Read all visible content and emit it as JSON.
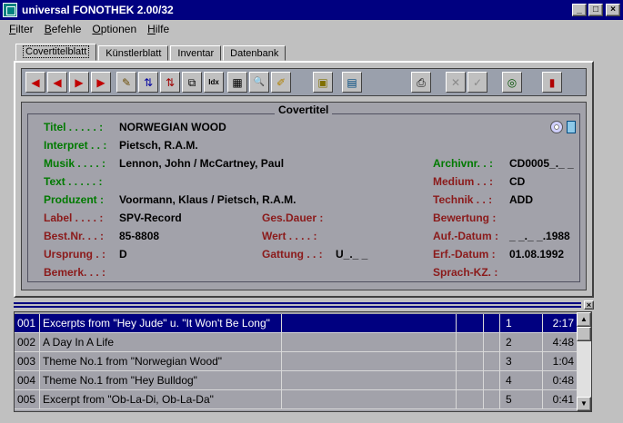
{
  "window": {
    "title": "universal FONOTHEK   2.00/32",
    "minimize": "_",
    "maximize": "□",
    "close": "×"
  },
  "menu": [
    "Filter",
    "Befehle",
    "Optionen",
    "Hilfe"
  ],
  "tabs": [
    "Covertitelblatt",
    "Künstlerblatt",
    "Inventar",
    "Datenbank"
  ],
  "toolbar": {
    "first": "◀",
    "prev": "◀",
    "next": "▶",
    "last": "▶",
    "edit": "✎",
    "sort_asc": "⇅",
    "sort_desc": "⇅",
    "copy": "⧉",
    "index": "Idx",
    "table": "▦",
    "search": "🔍",
    "clean": "✐",
    "archive": "▣",
    "cover": "▤",
    "print": "⎙",
    "cancel": "✕",
    "ok": "✓",
    "cd": "◎",
    "exit": "▮"
  },
  "cover": {
    "heading": "Covertitel",
    "titel_label": "Titel . . . . . :",
    "titel": "NORWEGIAN WOOD",
    "interpret_label": "Interpret . . :",
    "interpret": "Pietsch, R.A.M.",
    "musik_label": "Musik . . . . :",
    "musik": "Lennon, John / McCartney, Paul",
    "text_label": "Text . . . . . :",
    "text": "",
    "produzent_label": "Produzent  :",
    "produzent": "Voormann, Klaus / Pietsch, R.A.M.",
    "label_label": "Label . . . . :",
    "label": "SPV-Record",
    "bestnr_label": "Best.Nr.  . . :",
    "bestnr": "85-8808",
    "ursprung_label": "Ursprung  . :",
    "ursprung": "D",
    "bemerk_label": "Bemerk. . . :",
    "bemerk": "",
    "gesdauer_label": "Ges.Dauer :",
    "gesdauer": "",
    "wert_label": "Wert  . . . . :",
    "wert": "",
    "gattung_label": "Gattung . . :",
    "gattung": "U_._ _",
    "archivnr_label": "Archivnr.  . :",
    "archivnr": "CD0005_._ _",
    "medium_label": "Medium . . :",
    "medium": "CD",
    "technik_label": "Technik . . :",
    "technik": "ADD",
    "bewertung_label": "Bewertung  :",
    "bewertung": "",
    "aufdatum_label": "Auf.-Datum  :",
    "aufdatum": "_ _._ _.1988",
    "erfdatum_label": "Erf.-Datum  :",
    "erfdatum": "01.08.1992",
    "sprachkz_label": "Sprach-KZ. :",
    "sprachkz": ""
  },
  "tracks": [
    {
      "num": "001",
      "title": "Excerpts from \"Hey Jude\" u. \"It Won't Be Long\"",
      "track": "1",
      "duration": "2:17"
    },
    {
      "num": "002",
      "title": "A Day In A Life",
      "track": "2",
      "duration": "4:48"
    },
    {
      "num": "003",
      "title": "Theme No.1 from \"Norwegian Wood\"",
      "track": "3",
      "duration": "1:04"
    },
    {
      "num": "004",
      "title": "Theme No.1 from \"Hey Bulldog\"",
      "track": "4",
      "duration": "0:48"
    },
    {
      "num": "005",
      "title": "Excerpt from \"Ob-La-Di, Ob-La-Da\"",
      "track": "5",
      "duration": "0:41"
    }
  ],
  "scroll": {
    "up": "▲",
    "down": "▼",
    "close": "×"
  },
  "colors": {
    "titlebar": "#000080",
    "label_green": "#007a00",
    "label_red": "#8b1a1a",
    "selection": "#000080"
  }
}
